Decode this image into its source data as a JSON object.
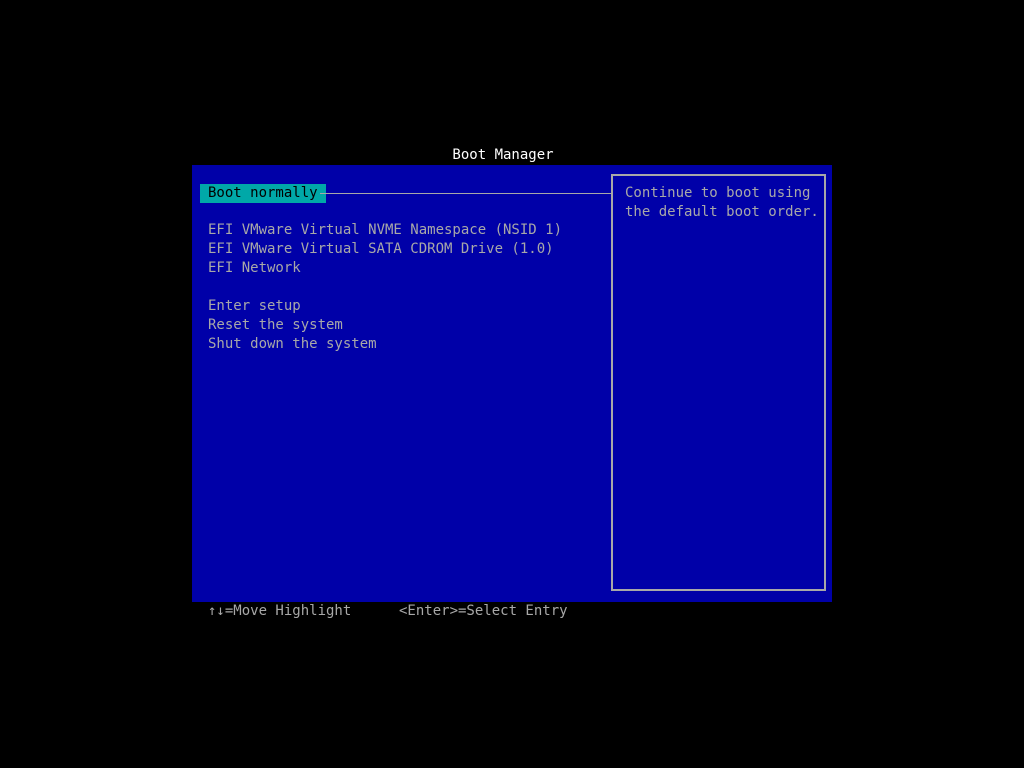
{
  "title": "Boot Manager",
  "menu": {
    "selected": "Boot normally",
    "boot_entries": [
      "EFI VMware Virtual NVME Namespace (NSID 1)",
      "EFI VMware Virtual SATA CDROM Drive (1.0)",
      "EFI Network"
    ],
    "system_entries": [
      "Enter setup",
      "Reset the system",
      "Shut down the system"
    ]
  },
  "help": {
    "line1": "Continue to boot using",
    "line2": "the default boot order."
  },
  "footer": {
    "move": "↑↓=Move Highlight",
    "select": "<Enter>=Select Entry"
  },
  "colors": {
    "background": "#000000",
    "panel": "#0000a8",
    "text": "#a8a8a8",
    "highlight": "#00a8a8"
  }
}
